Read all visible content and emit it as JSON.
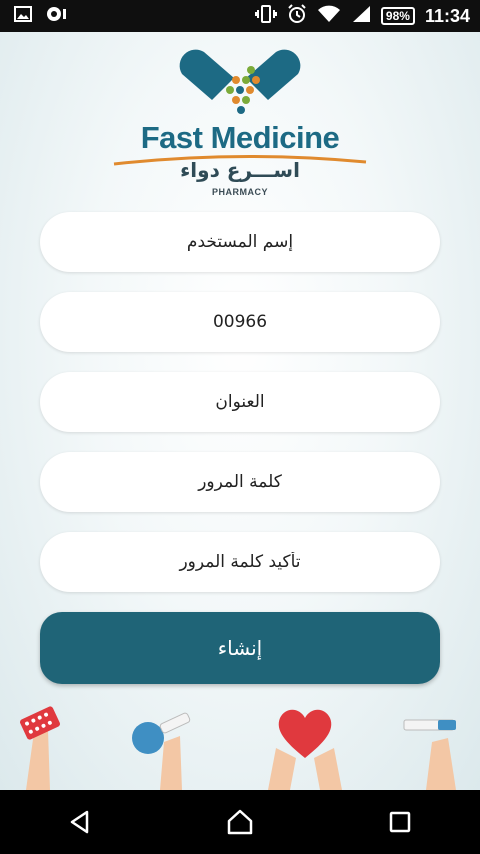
{
  "status_bar": {
    "battery": "98%",
    "time": "11:34",
    "icons": [
      "image-icon",
      "record-icon",
      "vibrate-icon",
      "alarm-icon",
      "wifi-icon",
      "signal-icon",
      "battery-icon"
    ]
  },
  "logo": {
    "title": "Fast Medicine",
    "arabic": "اســـرع دواء",
    "subtitle": "PHARMACY",
    "colors": {
      "primary": "#1d6a84",
      "dots": [
        "#e08a2e",
        "#7cab3a",
        "#1d6a84"
      ]
    }
  },
  "form": {
    "username_placeholder": "إسم المستخدم",
    "phone_value": "00966",
    "address_placeholder": "العنوان",
    "password_placeholder": "كلمة المرور",
    "confirm_password_placeholder": "تأكيد كلمة المرور"
  },
  "create_button": {
    "label": "إنشاء",
    "color": "#1f6477"
  },
  "illustration": {
    "items": [
      "pill-pack-hand",
      "flask-hand",
      "heart-hands",
      "syringe-hand"
    ],
    "heart_color": "#e0393e"
  },
  "nav_bar": {
    "buttons": [
      "back-icon",
      "home-icon",
      "recents-icon"
    ]
  }
}
